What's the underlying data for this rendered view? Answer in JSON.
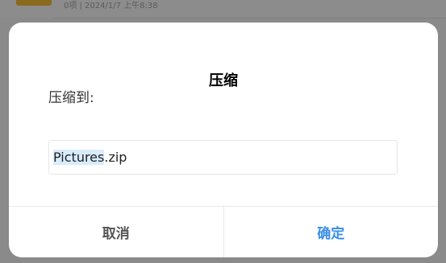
{
  "background": {
    "file_meta": "0项 | 2024/1/7 上午8:38"
  },
  "dialog": {
    "title": "压缩",
    "label": "压缩到:",
    "filename_selected": "Pictures",
    "filename_ext": ".zip",
    "cancel_label": "取消",
    "confirm_label": "确定"
  },
  "colors": {
    "accent": "#3a8ee6",
    "selection": "#d8ecfb",
    "overlay": "#8a8a8a"
  }
}
